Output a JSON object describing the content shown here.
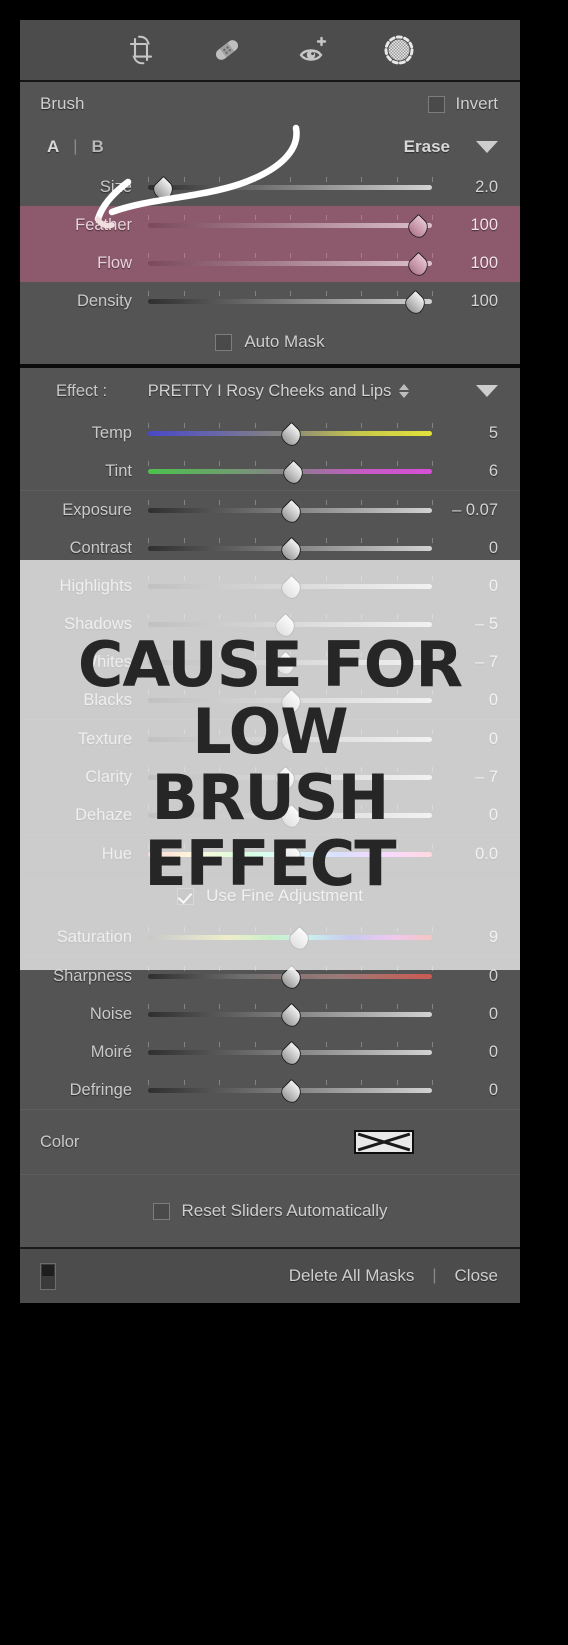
{
  "toolbar": {
    "tools": [
      {
        "name": "crop-overlay-icon",
        "label": "Crop Overlay"
      },
      {
        "name": "spot-removal-icon",
        "label": "Spot Removal"
      },
      {
        "name": "red-eye-correction-icon",
        "label": "Red Eye Correction"
      },
      {
        "name": "masking-brush-icon",
        "label": "Masking"
      }
    ]
  },
  "brush": {
    "title": "Brush",
    "invert_label": "Invert",
    "invert_checked": false,
    "preset_a": "A",
    "separator": "|",
    "preset_b": "B",
    "erase_label": "Erase",
    "auto_mask_label": "Auto Mask",
    "auto_mask_checked": false,
    "sliders": [
      {
        "label": "Size",
        "value": "2.0",
        "pos": 5,
        "highlight": false,
        "track": "t-plain"
      },
      {
        "label": "Feather",
        "value": "100",
        "pos": 95,
        "highlight": true,
        "track": ""
      },
      {
        "label": "Flow",
        "value": "100",
        "pos": 95,
        "highlight": true,
        "track": ""
      },
      {
        "label": "Density",
        "value": "100",
        "pos": 94,
        "highlight": false,
        "track": "t-plain"
      }
    ]
  },
  "effect": {
    "label": "Effect :",
    "value": "PRETTY I Rosy Cheeks and Lips",
    "groups": [
      {
        "name": "white-balance",
        "sliders": [
          {
            "label": "Temp",
            "value": "5",
            "pos": 50,
            "track": "t-temp"
          },
          {
            "label": "Tint",
            "value": "6",
            "pos": 51,
            "track": "t-tint"
          }
        ]
      },
      {
        "name": "tone",
        "sliders": [
          {
            "label": "Exposure",
            "value": "– 0.07",
            "pos": 50,
            "track": "t-plain"
          },
          {
            "label": "Contrast",
            "value": "0",
            "pos": 50,
            "track": "t-plain"
          },
          {
            "label": "Highlights",
            "value": "0",
            "pos": 50,
            "track": "t-plain"
          },
          {
            "label": "Shadows",
            "value": "– 5",
            "pos": 48,
            "track": "t-plain"
          },
          {
            "label": "Whites",
            "value": "– 7",
            "pos": 48,
            "track": "t-plain"
          },
          {
            "label": "Blacks",
            "value": "0",
            "pos": 50,
            "track": "t-plain"
          }
        ]
      },
      {
        "name": "presence",
        "sliders": [
          {
            "label": "Texture",
            "value": "0",
            "pos": 50,
            "track": "t-plain"
          },
          {
            "label": "Clarity",
            "value": "– 7",
            "pos": 48,
            "track": "t-plain"
          },
          {
            "label": "Dehaze",
            "value": "0",
            "pos": 50,
            "track": "t-plain"
          }
        ]
      },
      {
        "name": "hue",
        "sliders": [
          {
            "label": "Hue",
            "value": "0.0",
            "pos": 50,
            "track": "t-hue"
          }
        ]
      }
    ],
    "fine_adjustment_label": "Use Fine Adjustment",
    "fine_adjustment_checked": true,
    "saturation": {
      "label": "Saturation",
      "value": "9",
      "pos": 53,
      "track": "t-sat"
    },
    "detail": [
      {
        "label": "Sharpness",
        "value": "0",
        "pos": 50,
        "track": "t-sharp"
      },
      {
        "label": "Noise",
        "value": "0",
        "pos": 50,
        "track": "t-plain"
      },
      {
        "label": "Moiré",
        "value": "0",
        "pos": 50,
        "track": "t-plain"
      },
      {
        "label": "Defringe",
        "value": "0",
        "pos": 50,
        "track": "t-plain"
      }
    ],
    "color_label": "Color",
    "reset_label": "Reset Sliders Automatically",
    "reset_checked": false
  },
  "bottom_bar": {
    "delete_label": "Delete All Masks",
    "separator": "|",
    "close_label": "Close"
  },
  "annotation": {
    "caption_lines": [
      "CAUSE FOR",
      "LOW",
      "BRUSH",
      "EFFECT"
    ],
    "stroke_name": "hand-drawn-arrow"
  },
  "colors": {
    "panel_bg": "#545454",
    "toolbar_bg": "#4c4c4c",
    "highlight_row": "#8d5a6d",
    "text": "#cfcfcf",
    "caption_text": "#262626"
  }
}
